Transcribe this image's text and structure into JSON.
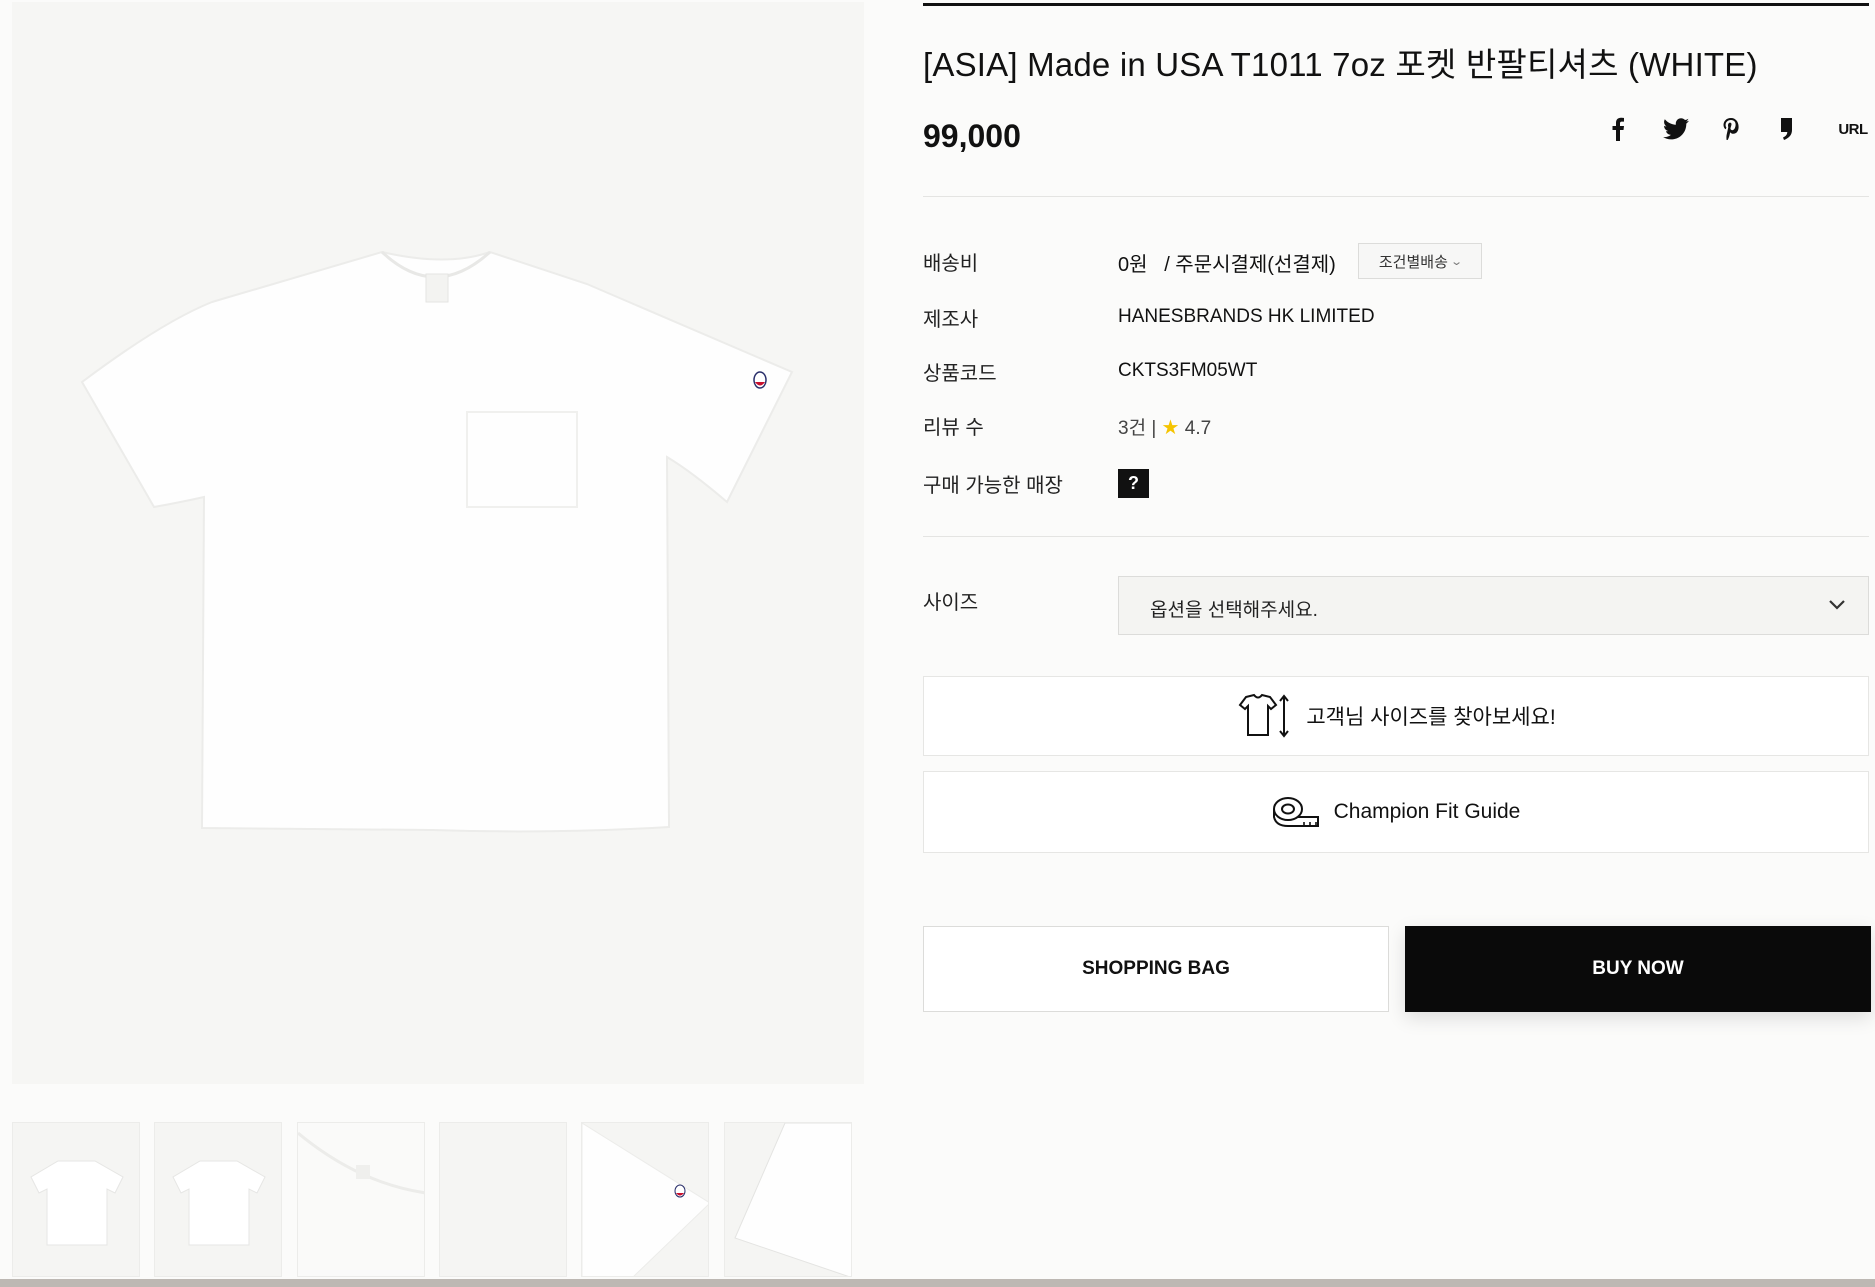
{
  "product": {
    "title": "[ASIA] Made in USA T1011 7oz 포켓 반팔티셔츠 (WHITE)",
    "price": "99,000"
  },
  "share": {
    "facebook_icon": "facebook-icon",
    "twitter_icon": "twitter-icon",
    "pinterest_icon": "pinterest-icon",
    "kakao_icon": "kakao-story-icon",
    "url_label": "URL"
  },
  "info": {
    "shipping_label": "배송비",
    "shipping_value": "0원   / 주문시결제(선결제)",
    "shipping_condition": "조건별배송",
    "maker_label": "제조사",
    "maker_value": "HANESBRANDS HK LIMITED",
    "code_label": "상품코드",
    "code_value": "CKTS3FM05WT",
    "review_label": "리뷰 수",
    "review_count": "3건 |",
    "review_rating": "4.7",
    "store_label": "구매 가능한 매장",
    "store_help": "?"
  },
  "size": {
    "label": "사이즈",
    "placeholder": "옵션을 선택해주세요."
  },
  "buttons": {
    "find_size": "고객님 사이즈를 찾아보세요!",
    "fit_guide": "Champion Fit Guide",
    "shopping_bag": "SHOPPING BAG",
    "buy_now": "BUY NOW"
  },
  "colors": {
    "background": "#fbfbfa",
    "primary": "#0a0a0a",
    "rating_star": "#f5c400"
  }
}
